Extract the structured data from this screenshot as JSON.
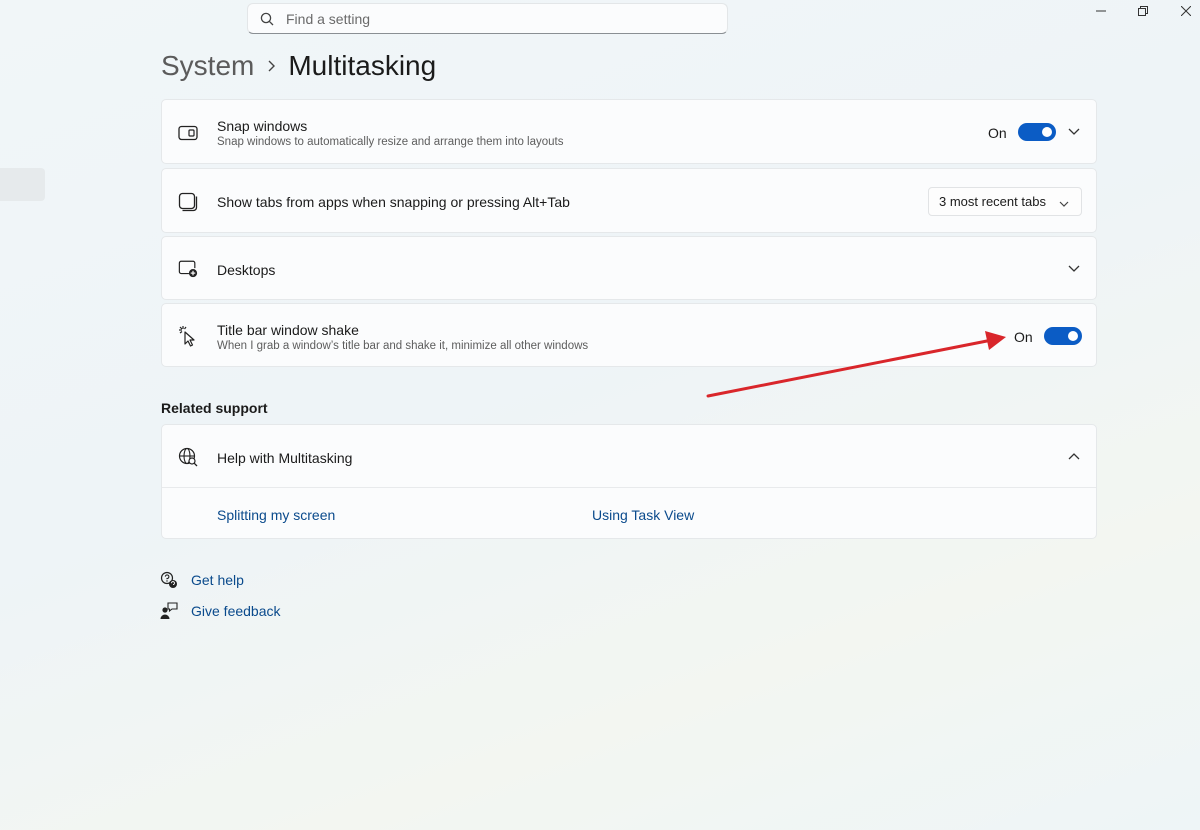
{
  "search": {
    "placeholder": "Find a setting"
  },
  "breadcrumb": {
    "parent": "System",
    "current": "Multitasking"
  },
  "settings": [
    {
      "title": "Snap windows",
      "subtitle": "Snap windows to automatically resize and arrange them into layouts",
      "state": "On",
      "icon": "snap-window-icon"
    },
    {
      "title": "Show tabs from apps when snapping or pressing Alt+Tab",
      "dropdown_value": "3 most recent tabs",
      "icon": "tabs-window-icon"
    },
    {
      "title": "Desktops",
      "icon": "add-desktop-icon"
    },
    {
      "title": "Title bar window shake",
      "subtitle": "When I grab a window’s title bar and shake it, minimize all other windows",
      "state": "On",
      "icon": "shake-cursor-icon"
    }
  ],
  "related_support": {
    "label": "Related support",
    "help_title": "Help with Multitasking",
    "links": [
      "Splitting my screen",
      "Using Task View"
    ]
  },
  "footer": {
    "get_help": "Get help",
    "give_feedback": "Give feedback"
  },
  "colors": {
    "accent": "#0b5cc5",
    "link": "#0a4a8c",
    "annotation_arrow": "#d9262b"
  }
}
